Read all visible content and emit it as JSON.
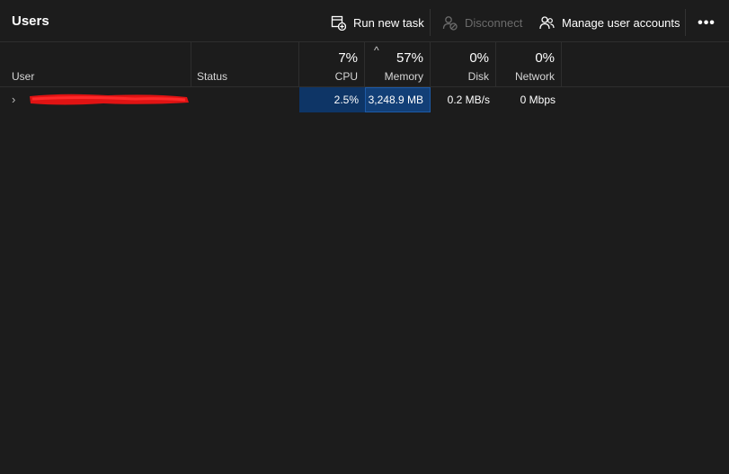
{
  "toolbar": {
    "title": "Users",
    "run_task_label": "Run new task",
    "disconnect_label": "Disconnect",
    "manage_label": "Manage user accounts",
    "more_label": "•••"
  },
  "columns": {
    "user": "User",
    "status": "Status",
    "cpu": {
      "label": "CPU",
      "pct": "7%"
    },
    "memory": {
      "label": "Memory",
      "pct": "57%"
    },
    "disk": {
      "label": "Disk",
      "pct": "0%"
    },
    "network": {
      "label": "Network",
      "pct": "0%"
    }
  },
  "row": {
    "cpu": "2.5%",
    "memory": "3,248.9 MB",
    "disk": "0.2 MB/s",
    "network": "0 Mbps"
  }
}
